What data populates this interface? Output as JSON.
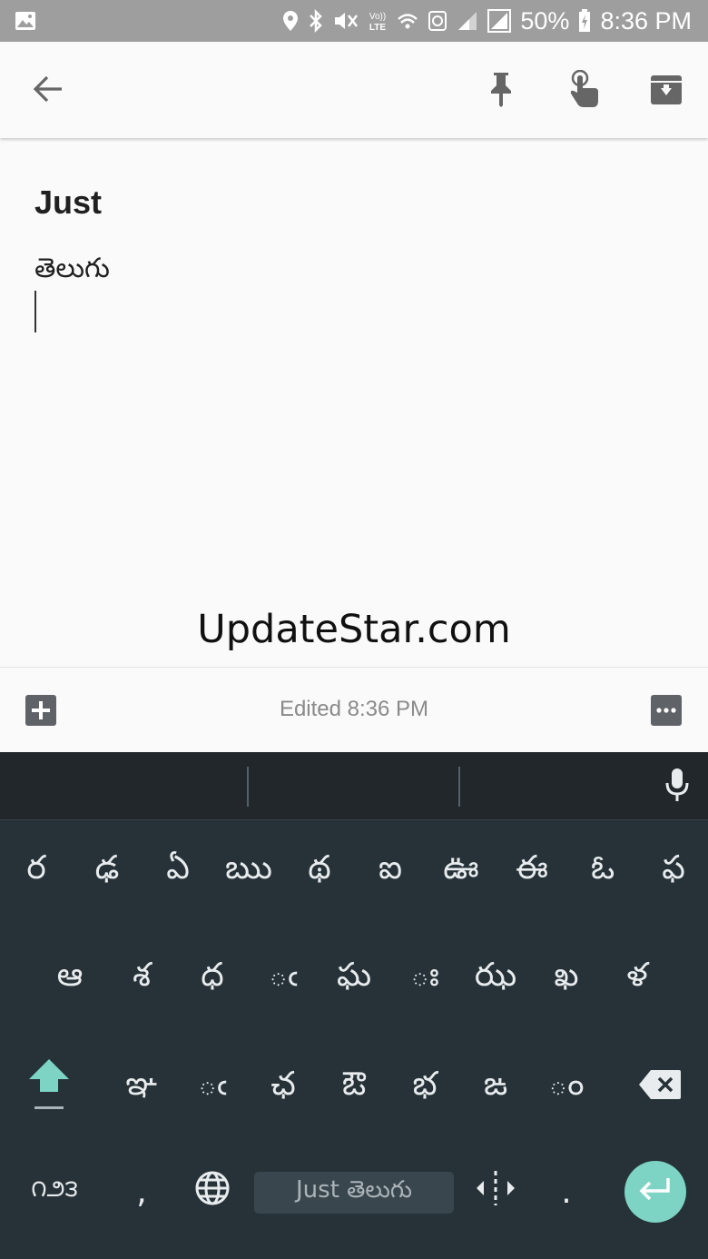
{
  "status_bar": {
    "battery": "50%",
    "time": "8:36 PM",
    "network": "LTE",
    "volte": "Vo))",
    "icons": [
      "gallery-icon",
      "location-icon",
      "bluetooth-icon",
      "mute-icon",
      "volte-icon",
      "wifi-icon",
      "data-icon",
      "signal-icon",
      "signal-icon",
      "battery-icon"
    ]
  },
  "app_bar": {
    "icons": [
      "back-arrow-icon",
      "pin-icon",
      "reminder-icon",
      "archive-icon"
    ]
  },
  "note": {
    "title": "Just",
    "body": "తెలుగు"
  },
  "watermark": "UpdateStar.com",
  "bottom_bar": {
    "edited": "Edited 8:36 PM",
    "icons": [
      "add-box-icon",
      "more-icon"
    ]
  },
  "keyboard": {
    "row1": [
      "ర",
      "ఢ",
      "ఏ",
      "ఋ",
      "థ",
      "ఐ",
      "ఊ",
      "ఈ",
      "ఓ",
      "ఫ"
    ],
    "row2": [
      "ఆ",
      "శ",
      "ధ",
      "◌ఁ",
      "ఘ",
      "◌ః",
      "ఝ",
      "ఖ",
      "ళ"
    ],
    "row3": [
      "ఞ",
      "◌ఁ",
      "ఛ",
      "ఔ",
      "భ",
      "ఙ",
      "◌ం"
    ],
    "symbols_label": "౧౨౩",
    "comma": ",",
    "period": ".",
    "spacebar_label": "Just తెలుగు",
    "accent_color": "#7dd3c4",
    "icons": [
      "microphone-icon",
      "shift-icon",
      "backspace-icon",
      "globe-icon",
      "cursor-move-icon",
      "enter-icon"
    ]
  }
}
